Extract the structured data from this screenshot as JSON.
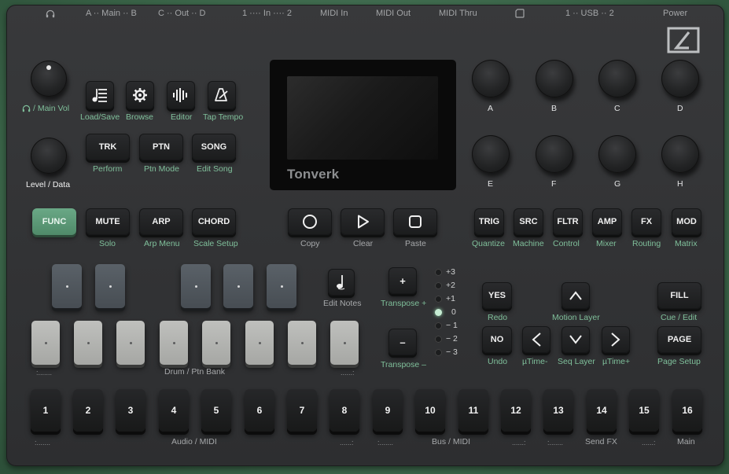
{
  "top_labels": {
    "headphones_icon": "headphones-icon",
    "main_out": "A ·· Main ·· B",
    "cv_out": "C ·· Out ·· D",
    "in": "1 ···· In ···· 2",
    "midi_in": "MIDI In",
    "midi_out": "MIDI Out",
    "midi_thru": "MIDI Thru",
    "sd_icon": "sd-card-icon",
    "usb": "1 ·· USB ·· 2",
    "power": "Power"
  },
  "screen": {
    "brand": "Tonverk"
  },
  "left": {
    "main_vol": "/ Main Vol",
    "level_data": "Level / Data",
    "buttons": [
      {
        "icon": "load-save-icon",
        "label": "Load/Save"
      },
      {
        "icon": "gear-icon",
        "label": "Browse"
      },
      {
        "icon": "waveform-icon",
        "label": "Editor"
      },
      {
        "icon": "metronome-icon",
        "label": "Tap Tempo"
      }
    ],
    "modes": [
      {
        "label": "TRK",
        "sub": "Perform"
      },
      {
        "label": "PTN",
        "sub": "Ptn Mode"
      },
      {
        "label": "SONG",
        "sub": "Edit Song"
      }
    ]
  },
  "knobs": [
    "A",
    "B",
    "C",
    "D",
    "E",
    "F",
    "G",
    "H"
  ],
  "row_func": {
    "func": "FUNC",
    "mute": "MUTE",
    "mute_sub": "Solo",
    "arp": "ARP",
    "arp_sub": "Arp Menu",
    "chord": "CHORD",
    "chord_sub": "Scale Setup"
  },
  "transport": [
    {
      "icon": "circle-icon",
      "label": "Copy"
    },
    {
      "icon": "play-triangle-icon",
      "label": "Clear"
    },
    {
      "icon": "square-icon",
      "label": "Paste"
    }
  ],
  "params": [
    {
      "label": "TRIG",
      "sub": "Quantize"
    },
    {
      "label": "SRC",
      "sub": "Machine"
    },
    {
      "label": "FLTR",
      "sub": "Control"
    },
    {
      "label": "AMP",
      "sub": "Mixer"
    },
    {
      "label": "FX",
      "sub": "Routing"
    },
    {
      "label": "MOD",
      "sub": "Matrix"
    }
  ],
  "keyboard": {
    "bank_label": "Drum / Ptn Bank",
    "bracket_left": ":.......",
    "bracket_right": "......:",
    "edit_notes": "Edit Notes",
    "edit_notes_icon": "note-icon"
  },
  "transpose": {
    "plus": "+",
    "minus": "–",
    "plus_label": "Transpose +",
    "minus_label": "Transpose –",
    "levels": [
      "+3",
      "+2",
      "+1",
      "0",
      "− 1",
      "− 2",
      "− 3"
    ],
    "active_level": "0"
  },
  "nav": {
    "yes": "YES",
    "yes_sub": "Redo",
    "no": "NO",
    "no_sub": "Undo",
    "up_sub": "Motion Layer",
    "left_sub": "µTime-",
    "down_sub": "Seq Layer",
    "right_sub": "µTime+",
    "fill": "FILL",
    "fill_sub": "Cue / Edit",
    "page": "PAGE",
    "page_sub": "Page Setup"
  },
  "steps": [
    "1",
    "2",
    "3",
    "4",
    "5",
    "6",
    "7",
    "8",
    "9",
    "10",
    "11",
    "12",
    "13",
    "14",
    "15",
    "16"
  ],
  "step_groups": {
    "audio_midi": "Audio / MIDI",
    "bus_midi": "Bus / MIDI",
    "send_fx": "Send FX",
    "main": "Main",
    "bracket_open": ":.......",
    "bracket_close": "......:"
  },
  "colors": {
    "accent": "#5b9a77",
    "label_green": "#7fbf9a",
    "led_on": "#c6ecd3"
  }
}
